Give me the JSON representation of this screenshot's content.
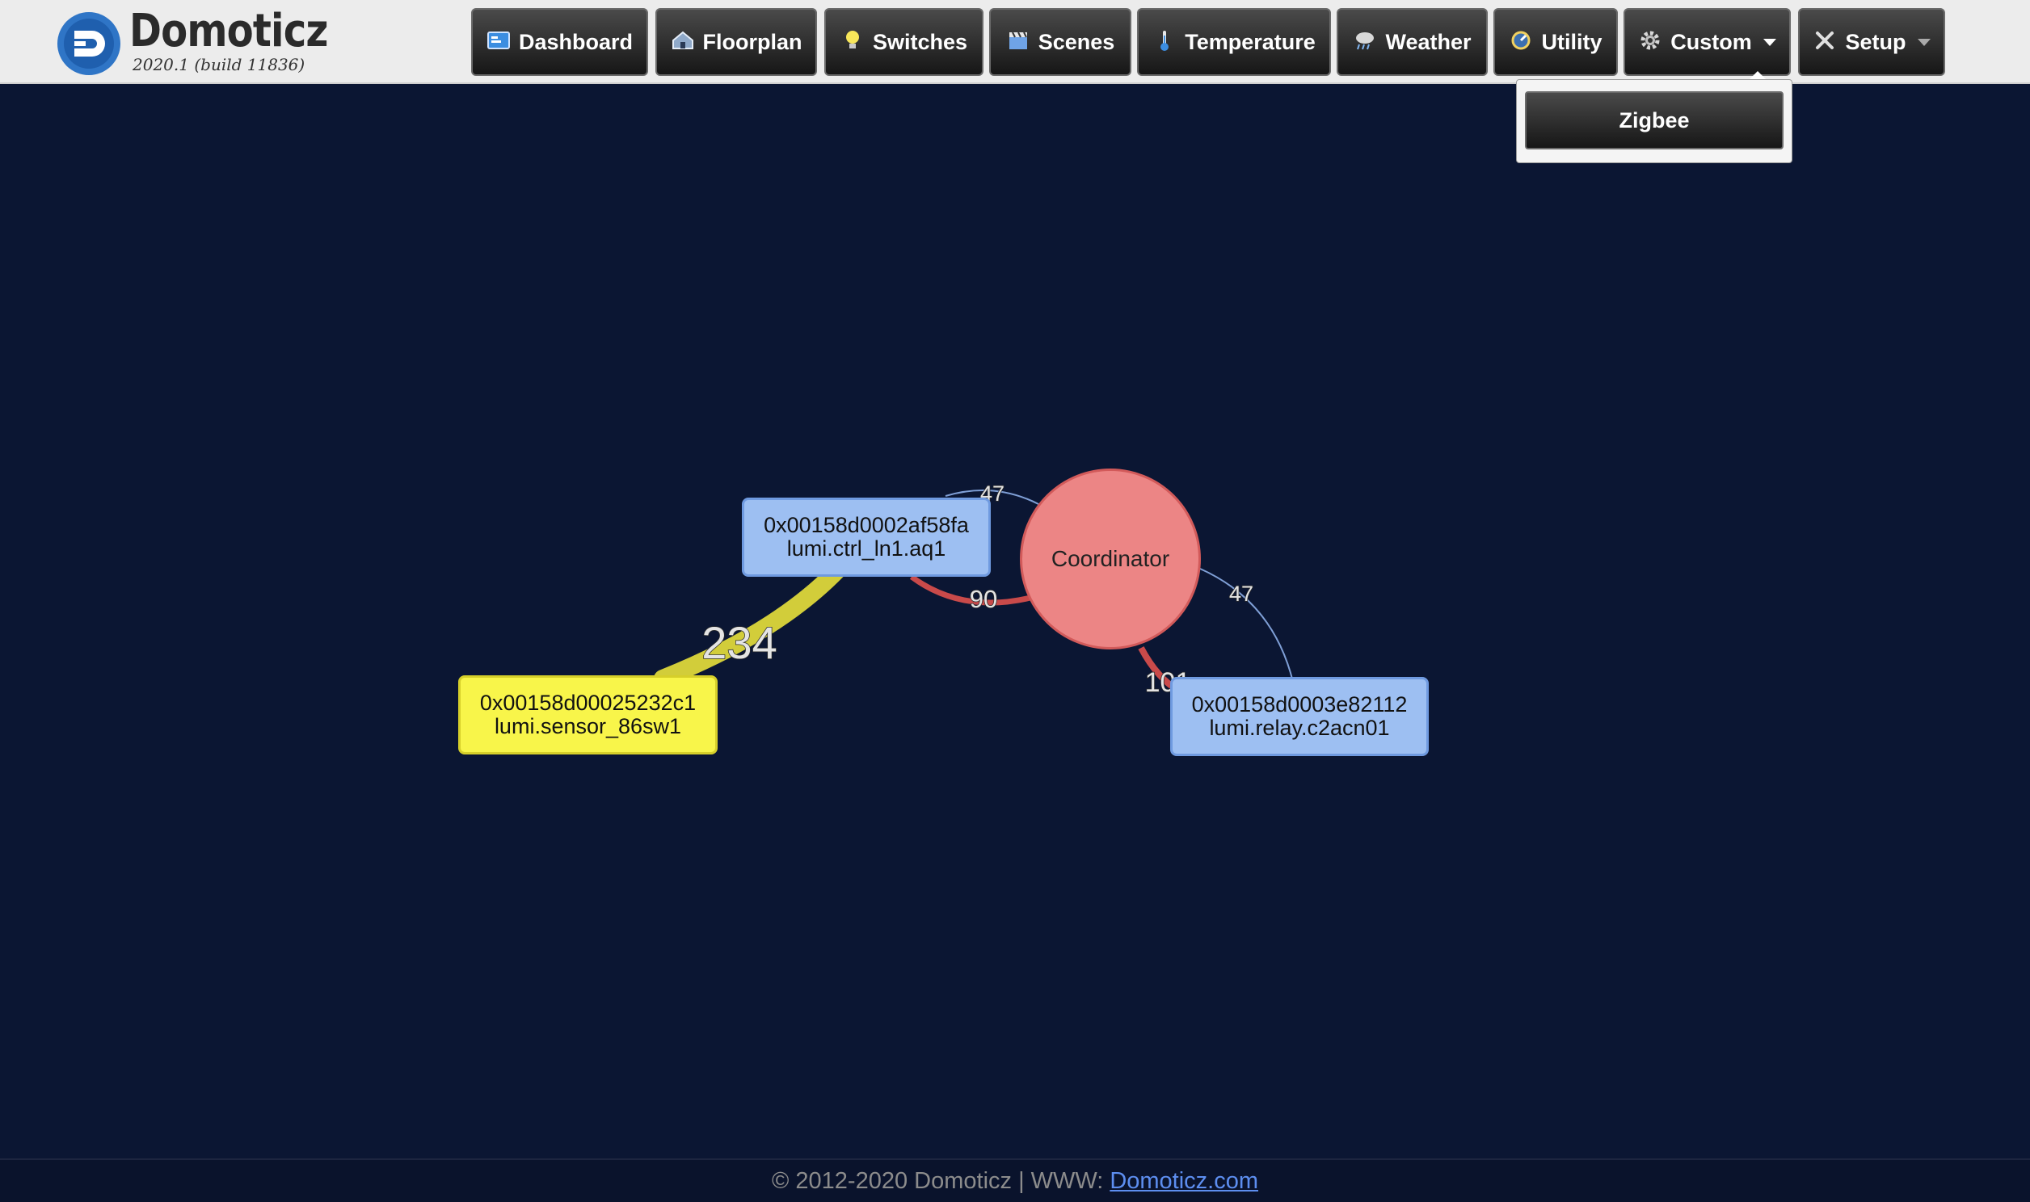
{
  "app": {
    "name": "Domoticz",
    "version": "2020.1 (build 11836)"
  },
  "nav": {
    "items": [
      {
        "label": "Dashboard",
        "icon": "dashboard-icon"
      },
      {
        "label": "Floorplan",
        "icon": "floorplan-icon"
      },
      {
        "label": "Switches",
        "icon": "lightbulb-icon"
      },
      {
        "label": "Scenes",
        "icon": "clapperboard-icon"
      },
      {
        "label": "Temperature",
        "icon": "thermometer-icon"
      },
      {
        "label": "Weather",
        "icon": "cloud-rain-icon"
      },
      {
        "label": "Utility",
        "icon": "utility-icon"
      },
      {
        "label": "Custom",
        "icon": "gear-icon",
        "has_dropdown": true
      },
      {
        "label": "Setup",
        "icon": "tools-icon",
        "has_dropdown": true
      }
    ],
    "open_menu": "Custom",
    "dropdown_items": [
      "Zigbee"
    ]
  },
  "graph": {
    "nodes": {
      "coordinator": {
        "label": "Coordinator",
        "color": "#ec8585"
      },
      "ctrl": {
        "address": "0x00158d0002af58fa",
        "model": "lumi.ctrl_ln1.aq1",
        "color": "#9dbff2"
      },
      "sensor": {
        "address": "0x00158d00025232c1",
        "model": "lumi.sensor_86sw1",
        "color": "#f8f54a"
      },
      "relay": {
        "address": "0x00158d0003e82112",
        "model": "lumi.relay.c2acn01",
        "color": "#9dbff2"
      }
    },
    "links": {
      "ctrl_coord_top": {
        "label": "47",
        "color": "#7f9fd6"
      },
      "ctrl_coord_bottom": {
        "label": "90",
        "color": "#c94a4a"
      },
      "sensor_ctrl": {
        "label": "234",
        "color": "#d2cd3a"
      },
      "coord_relay_thin": {
        "label": "47",
        "color": "#7f9fd6"
      },
      "coord_relay_thick": {
        "label": "101",
        "color": "#c94a4a"
      }
    }
  },
  "footer": {
    "copyright": "© 2012-2020 Domoticz | WWW:",
    "link_text": "Domoticz.com"
  }
}
